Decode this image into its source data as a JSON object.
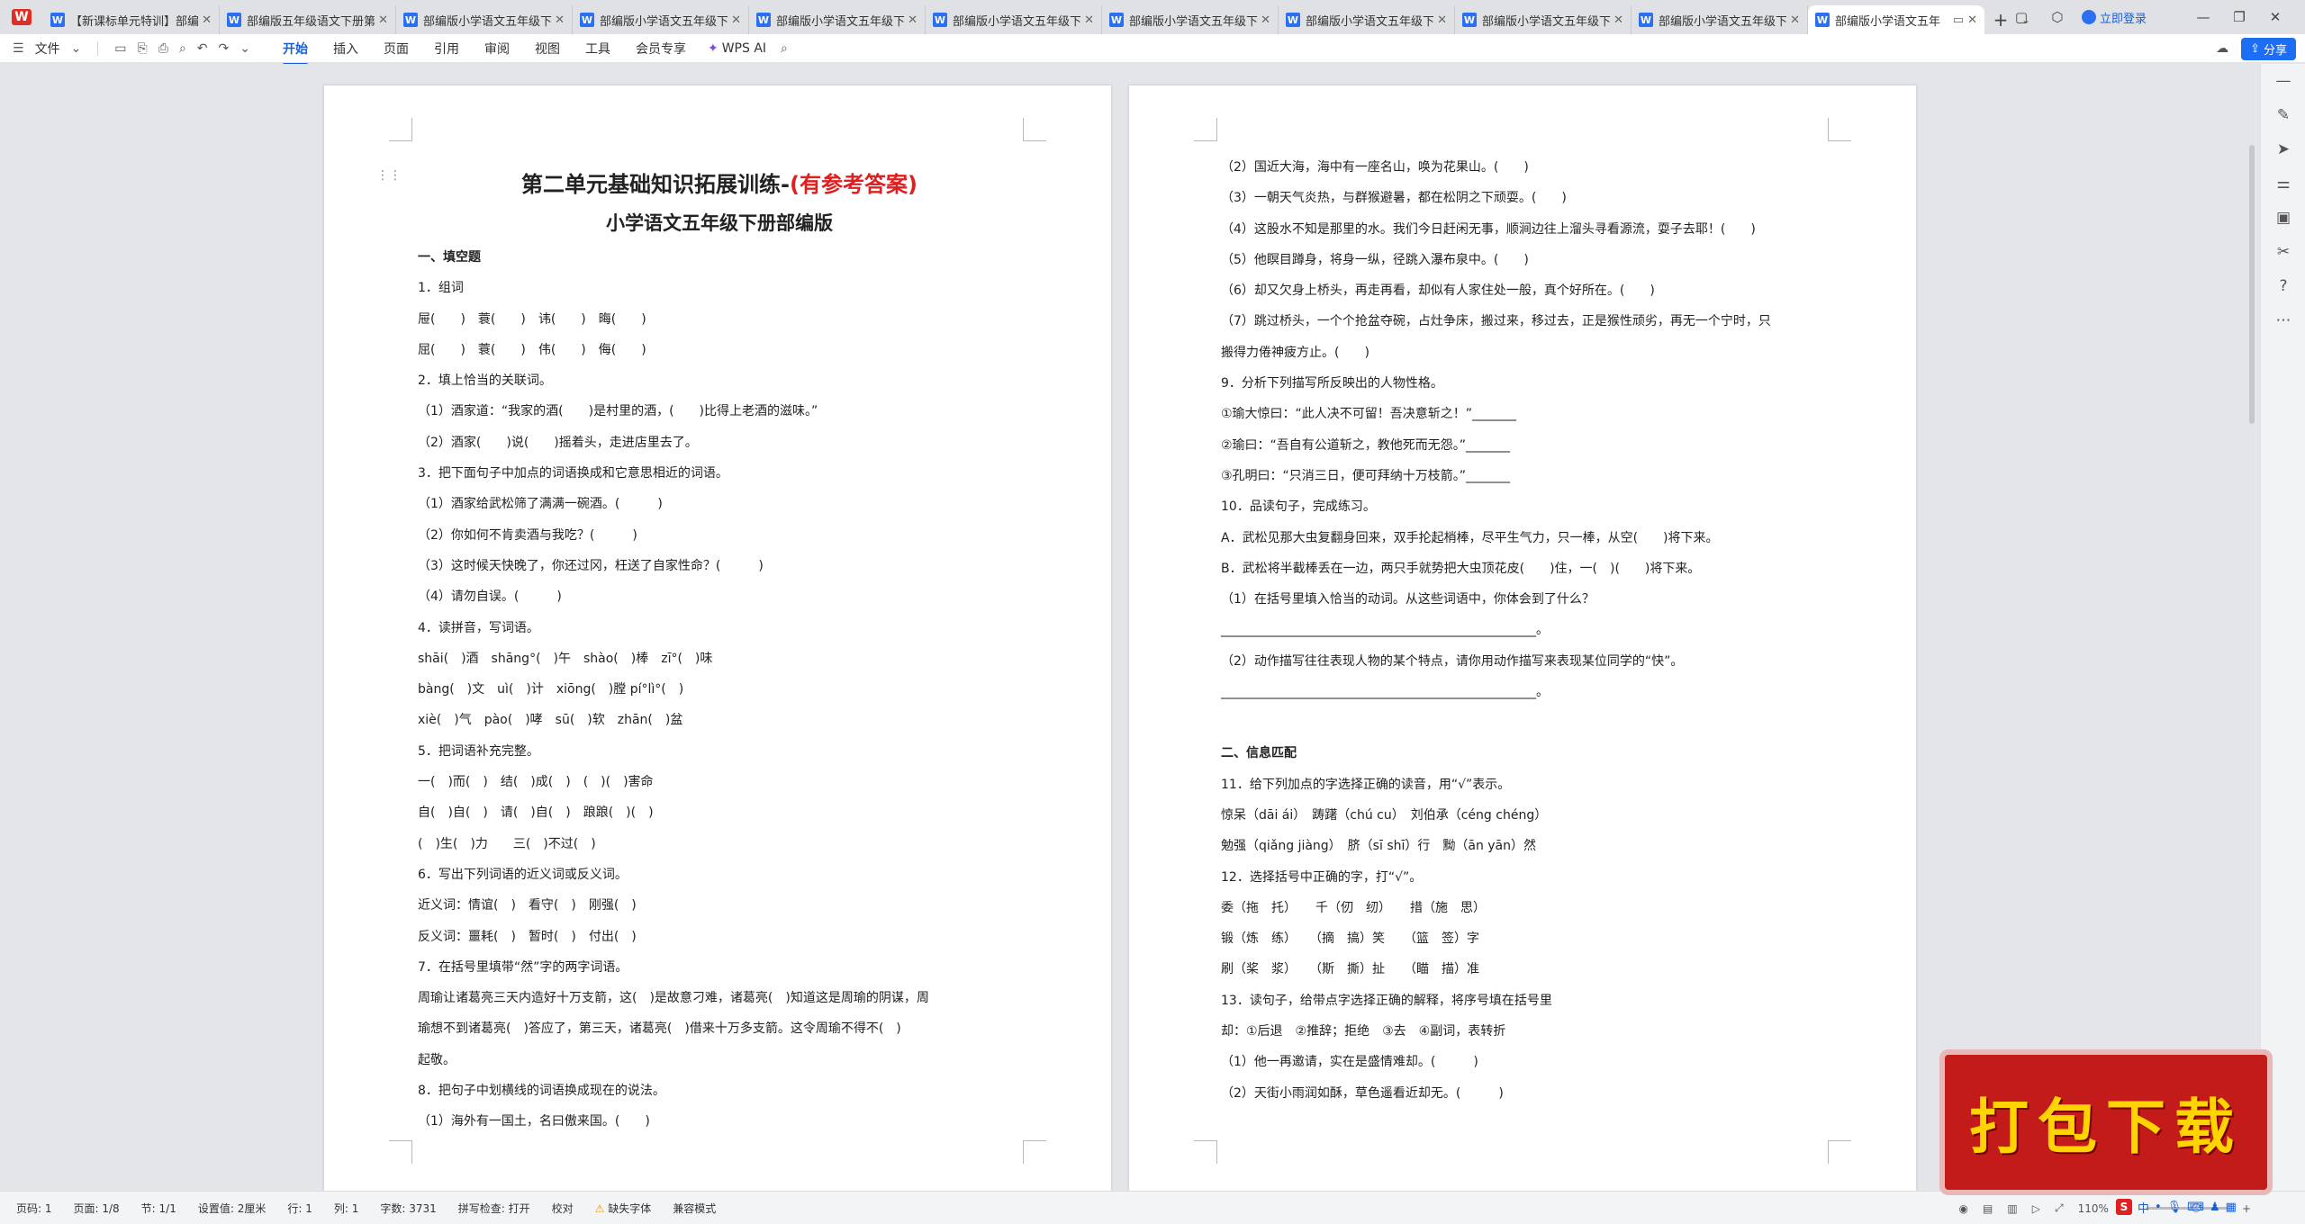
{
  "tabs": [
    {
      "label": "【新课标单元特训】部编版"
    },
    {
      "label": "部编版五年级语文下册第二单元"
    },
    {
      "label": "部编版小学语文五年级下册"
    },
    {
      "label": "部编版小学语文五年级下册"
    },
    {
      "label": "部编版小学语文五年级下册"
    },
    {
      "label": "部编版小学语文五年级下册"
    },
    {
      "label": "部编版小学语文五年级下册"
    },
    {
      "label": "部编版小学语文五年级下册"
    },
    {
      "label": "部编版小学语文五年级下册"
    },
    {
      "label": "部编版小学语文五年级下册"
    },
    {
      "label": "部编版小学语文五年"
    }
  ],
  "tab_icon_letter": "W",
  "login_label": "立即登录",
  "menu": {
    "file": "文件",
    "tabs": [
      "开始",
      "插入",
      "页面",
      "引用",
      "审阅",
      "视图",
      "工具",
      "会员专享"
    ],
    "wps_ai": "WPS AI",
    "share": "分享"
  },
  "page1": {
    "title_black": "第二单元基础知识拓展训练-",
    "title_red": "(有参考答案)",
    "subtitle": "小学语文五年级下册部编版",
    "lines": [
      "一、填空题",
      "1．组词",
      "屉(　　)　蓑(　　)　讳(　　)　晦(　　)",
      "屈(　　)　蓑(　　)　伟(　　)　侮(　　)",
      "2．填上恰当的关联词。",
      "（1）酒家道：“我家的酒(　　)是村里的酒，(　　)比得上老酒的滋味。”",
      "（2）酒家(　　)说(　　)摇着头，走进店里去了。",
      "3．把下面句子中加点的词语换成和它意思相近的词语。",
      "（1）酒家给武松筛了满满一碗酒。(　　　)",
      "（2）你如何不肯卖酒与我吃？(　　　)",
      "（3）这时候天快晚了，你还过冈，枉送了自家性命？(　　　)",
      "（4）请勿自误。(　　　)",
      "4．读拼音，写词语。",
      "shāi(　)酒　shāng°(　)午　shào(　)棒　zī°(　)味",
      "bàng(　)文　uì(　)计　xiōng(　)膛 pí°lì°(　)",
      "xiè(　)气　pào(　)哮　sū(　)软　zhān(　)盆",
      "5．把词语补充完整。",
      "一(　)而(　)　结(　)成(　)　(　)(　)害命",
      "自(　)自(　)　请(　)自(　)　踉踉(　)(　)",
      "(　)生(　)力　　三(　)不过(　)",
      "6．写出下列词语的近义词或反义词。",
      "近义词：情谊(　)　看守(　)　刚强(　)",
      "反义词：噩耗(　)　暂时(　)　付出(　)",
      "7．在括号里填带“然”字的两字词语。",
      "周瑜让诸葛亮三天内造好十万支箭，这(　)是故意刁难，诸葛亮(　)知道这是周瑜的阴谋，周",
      "瑜想不到诸葛亮(　)答应了，第三天，诸葛亮(　)借来十万多支箭。这令周瑜不得不(　)",
      "起敬。",
      "8．把句子中划横线的词语换成现在的说法。",
      "（1）海外有一国土，名曰傲来国。(　　)"
    ]
  },
  "page2": {
    "lines_a": [
      "（2）国近大海，海中有一座名山，唤为花果山。(　　)",
      "（3）一朝天气炎热，与群猴避暑，都在松阴之下顽耍。(　　)",
      "（4）这股水不知是那里的水。我们今日赶闲无事，顺涧边往上溜头寻看源流，耍子去耶！(　　)",
      "（5）他瞑目蹲身，将身一纵，径跳入瀑布泉中。(　　)",
      "（6）却又欠身上桥头，再走再看，却似有人家住处一般，真个好所在。(　　)",
      "（7）跳过桥头，一个个抢盆夺碗，占灶争床，搬过来，移过去，正是猴性顽劣，再无一个宁时，只",
      "搬得力倦神疲方止。(　　)",
      "9．分析下列描写所反映出的人物性格。",
      "①瑜大惊曰：“此人决不可留！吾决意斩之！”_______",
      "②瑜曰：“吾自有公道斩之，教他死而无怨。”_______",
      "③孔明曰：“只消三日，便可拜纳十万枝箭。”_______",
      "10．品读句子，完成练习。",
      "A．武松见那大虫复翻身回来，双手抡起梢棒，尽平生气力，只一棒，从空(　　)将下来。",
      "B．武松将半截棒丢在一边，两只手就势把大虫顶花皮(　　)住，一(　)(　　)将下来。",
      "（1）在括号里填入恰当的动词。从这些词语中，你体会到了什么？",
      "__________________________________________________。",
      "（2）动作描写往往表现人物的某个特点，请你用动作描写来表现某位同学的“快”。",
      "__________________________________________________。"
    ],
    "lines_b": [
      "二、信息匹配",
      "11．给下列加点的字选择正确的读音，用“√”表示。",
      "惊呆（dāi ái）　踌躇（chú cu）　刘伯承（céng chéng）",
      "勉强（qiǎng jiàng）　脐（sī shī）行　黝（ān yān）然",
      "12．选择括号中正确的字，打“√”。",
      "委（拖　托）　　千（仞　纫）　　措（施　思）",
      "锻（炼　练）　　（摘　搞）笑　　（篮　签）字",
      "刷（桨　浆）　　（斯　撕）扯　　（瞄　描）准",
      "13．读句子，给带点字选择正确的解释，将序号填在括号里",
      "却：①后退　②推辞；拒绝　③去　④副词，表转折",
      "（1）他一再邀请，实在是盛情难却。(　　　)",
      "（2）天街小雨润如酥，草色遥看近却无。(　　　)"
    ]
  },
  "status": {
    "page": "页码: 1",
    "pages": "页面: 1/8",
    "section": "节: 1/1",
    "setting": "设置值: 2厘米",
    "row": "行: 1",
    "col": "列: 1",
    "wordcount": "字数: 3731",
    "spell": "拼写检查: 打开",
    "proof": "校对",
    "missing_font": "缺失字体",
    "compat": "兼容模式",
    "zoom": "110%",
    "zoom_level_percent": 110
  },
  "badge_text": "打包下载",
  "ime": {
    "logo": "S",
    "lang": "中"
  }
}
